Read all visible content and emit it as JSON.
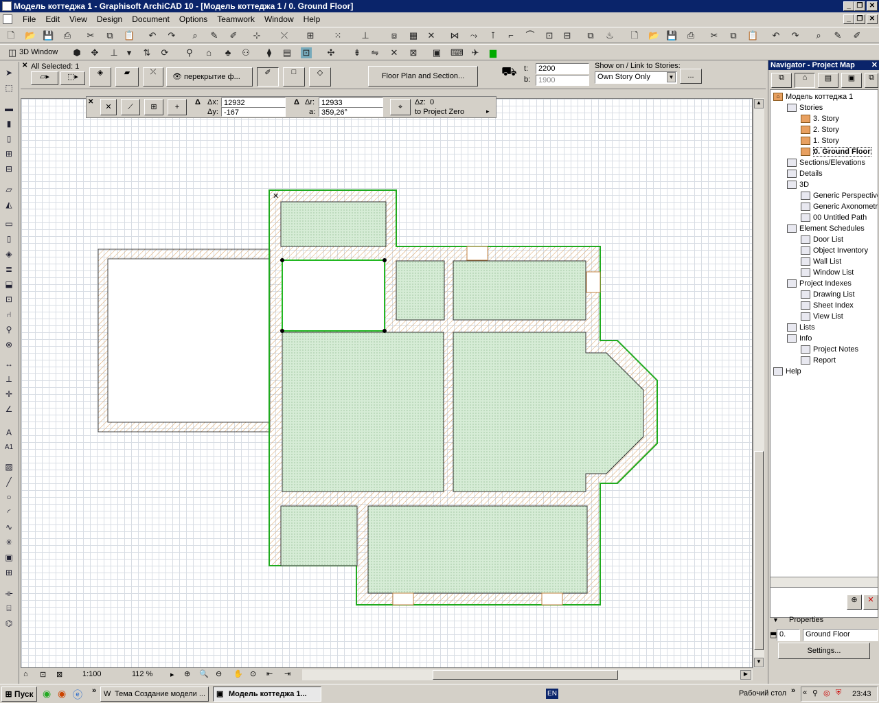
{
  "window": {
    "title": "Модель коттеджа 1 - Graphisoft ArchiCAD 10 - [Модель коттеджа 1 / 0. Ground Floor]"
  },
  "menu": [
    "File",
    "Edit",
    "View",
    "Design",
    "Document",
    "Options",
    "Teamwork",
    "Window",
    "Help"
  ],
  "toolbar2": {
    "view3d_label": "3D Window"
  },
  "infobox": {
    "selection": "All Selected: 1",
    "layer_label": "перекрытие ф...",
    "section_button": "Floor Plan and Section...",
    "t_label": "t:",
    "t_value": "2200",
    "b_label": "b:",
    "b_value": "1900",
    "show_on_label": "Show on / Link to Stories:",
    "show_on_value": "Own Story Only",
    "more_button": "..."
  },
  "coords": {
    "dx_label": "Δx:",
    "dx_value": "12932",
    "dy_label": "Δy:",
    "dy_value": "-167",
    "dr_label": "Δr:",
    "dr_value": "12933",
    "a_label": "a:",
    "a_value": "359,26°",
    "dz_label": "Δz:",
    "dz_value": "0",
    "ref_label": "to Project Zero"
  },
  "status": {
    "scale": "1:100",
    "zoom": "112 %"
  },
  "navigator": {
    "title": "Navigator - Project Map",
    "project": "Модель коттеджа 1",
    "tree": [
      {
        "label": "Stories",
        "indent": 1,
        "folder": false
      },
      {
        "label": "3. Story",
        "indent": 2,
        "folder": true
      },
      {
        "label": "2. Story",
        "indent": 2,
        "folder": true
      },
      {
        "label": "1. Story",
        "indent": 2,
        "folder": true
      },
      {
        "label": "0. Ground Floor",
        "indent": 2,
        "folder": true,
        "selected": true
      },
      {
        "label": "Sections/Elevations",
        "indent": 1,
        "folder": false
      },
      {
        "label": "Details",
        "indent": 1,
        "folder": false
      },
      {
        "label": "3D",
        "indent": 1,
        "folder": false
      },
      {
        "label": "Generic Perspective",
        "indent": 2,
        "folder": false
      },
      {
        "label": "Generic Axonometry",
        "indent": 2,
        "folder": false
      },
      {
        "label": "00 Untitled Path",
        "indent": 2,
        "folder": false
      },
      {
        "label": "Element Schedules",
        "indent": 1,
        "folder": false
      },
      {
        "label": "Door List",
        "indent": 2,
        "folder": false
      },
      {
        "label": "Object Inventory",
        "indent": 2,
        "folder": false
      },
      {
        "label": "Wall List",
        "indent": 2,
        "folder": false
      },
      {
        "label": "Window List",
        "indent": 2,
        "folder": false
      },
      {
        "label": "Project Indexes",
        "indent": 1,
        "folder": false
      },
      {
        "label": "Drawing List",
        "indent": 2,
        "folder": false
      },
      {
        "label": "Sheet Index",
        "indent": 2,
        "folder": false
      },
      {
        "label": "View List",
        "indent": 2,
        "folder": false
      },
      {
        "label": "Lists",
        "indent": 1,
        "folder": false
      },
      {
        "label": "Info",
        "indent": 1,
        "folder": false
      },
      {
        "label": "Project Notes",
        "indent": 2,
        "folder": false
      },
      {
        "label": "Report",
        "indent": 2,
        "folder": false
      },
      {
        "label": "Help",
        "indent": 0,
        "folder": false
      }
    ],
    "properties_label": "Properties",
    "story_num": "0.",
    "story_name": "Ground Floor",
    "settings_button": "Settings..."
  },
  "taskbar": {
    "start": "Пуск",
    "task1": "Тема Создание модели ...",
    "task2": "Модель коттеджа 1...",
    "lang": "EN",
    "desktop": "Рабочий стол",
    "clock": "23:43"
  },
  "colors": {
    "wall_green": "#1faa1f",
    "fill_green": "#d6ecd6",
    "hatch": "#d9a060",
    "selection_green": "#22b822"
  }
}
